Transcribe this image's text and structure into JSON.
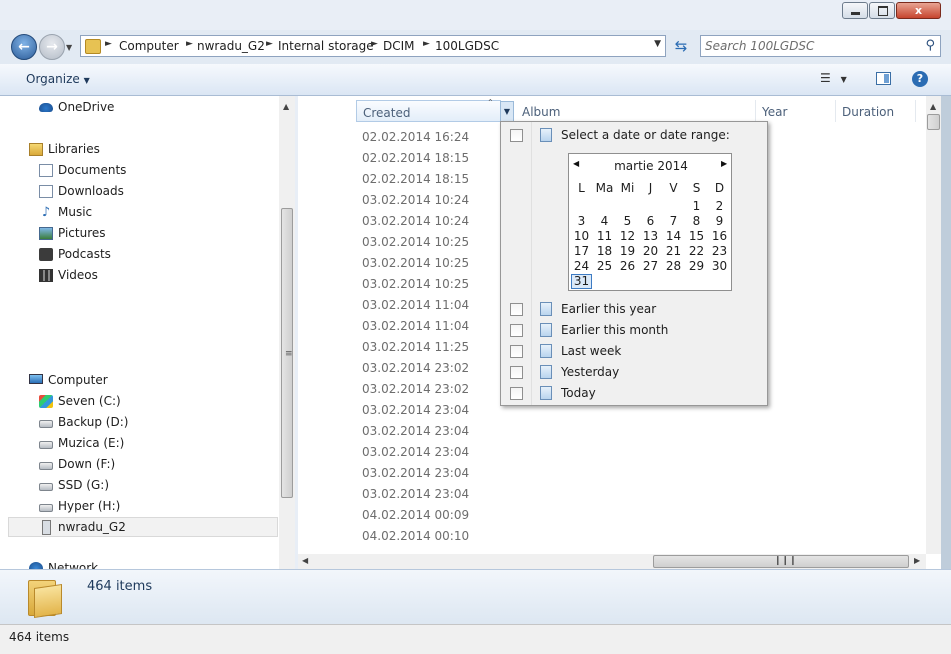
{
  "window": {
    "controls": {
      "minimize_icon": "minimize-icon",
      "maximize_icon": "maximize-icon",
      "close_icon": "close-icon",
      "close_glyph": "x"
    }
  },
  "address_bar": {
    "breadcrumbs": [
      "Computer",
      "nwradu_G2",
      "Internal storage",
      "DCIM",
      "100LGDSC"
    ]
  },
  "search": {
    "placeholder": "Search 100LGDSC"
  },
  "toolbar": {
    "organize_label": "Organize"
  },
  "navigation": {
    "favorites": [
      {
        "label": "OneDrive",
        "icon": "onedrive-icon"
      }
    ],
    "libraries_label": "Libraries",
    "libraries": [
      {
        "label": "Documents",
        "icon": "documents-icon"
      },
      {
        "label": "Downloads",
        "icon": "downloads-icon"
      },
      {
        "label": "Music",
        "icon": "music-icon"
      },
      {
        "label": "Pictures",
        "icon": "pictures-icon"
      },
      {
        "label": "Podcasts",
        "icon": "podcasts-icon"
      },
      {
        "label": "Videos",
        "icon": "videos-icon"
      }
    ],
    "computer_label": "Computer",
    "drives": [
      {
        "label": "Seven (C:)",
        "icon": "windows-drive-icon"
      },
      {
        "label": "Backup (D:)",
        "icon": "drive-icon"
      },
      {
        "label": "Muzica (E:)",
        "icon": "drive-icon"
      },
      {
        "label": "Down (F:)",
        "icon": "drive-icon"
      },
      {
        "label": "SSD (G:)",
        "icon": "drive-icon"
      },
      {
        "label": "Hyper (H:)",
        "icon": "drive-icon"
      },
      {
        "label": "nwradu_G2",
        "icon": "phone-icon",
        "selected": true
      }
    ],
    "network_label": "Network"
  },
  "columns": {
    "created": "Created",
    "album": "Album",
    "year": "Year",
    "duration": "Duration"
  },
  "rows": [
    "02.02.2014 16:24",
    "02.02.2014 18:15",
    "02.02.2014 18:15",
    "03.02.2014 10:24",
    "03.02.2014 10:24",
    "03.02.2014 10:25",
    "03.02.2014 10:25",
    "03.02.2014 10:25",
    "03.02.2014 11:04",
    "03.02.2014 11:04",
    "03.02.2014 11:25",
    "03.02.2014 23:02",
    "03.02.2014 23:02",
    "03.02.2014 23:04",
    "03.02.2014 23:04",
    "03.02.2014 23:04",
    "03.02.2014 23:04",
    "03.02.2014 23:04",
    "04.02.2014 00:09",
    "04.02.2014 00:10"
  ],
  "filter_popup": {
    "range_label": "Select a date or date range:",
    "calendar": {
      "month_title": "martie 2014",
      "weekdays": [
        "L",
        "Ma",
        "Mi",
        "J",
        "V",
        "S",
        "D"
      ],
      "weeks": [
        [
          "",
          "",
          "",
          "",
          "",
          "1",
          "2"
        ],
        [
          "3",
          "4",
          "5",
          "6",
          "7",
          "8",
          "9"
        ],
        [
          "10",
          "11",
          "12",
          "13",
          "14",
          "15",
          "16"
        ],
        [
          "17",
          "18",
          "19",
          "20",
          "21",
          "22",
          "23"
        ],
        [
          "24",
          "25",
          "26",
          "27",
          "28",
          "29",
          "30"
        ],
        [
          "31",
          "",
          "",
          "",
          "",
          "",
          ""
        ]
      ],
      "today": "31"
    },
    "options": [
      "Earlier this year",
      "Earlier this month",
      "Last week",
      "Yesterday",
      "Today"
    ]
  },
  "details_pane": {
    "item_count": "464 items"
  },
  "status_bar": {
    "text": "464 items"
  }
}
